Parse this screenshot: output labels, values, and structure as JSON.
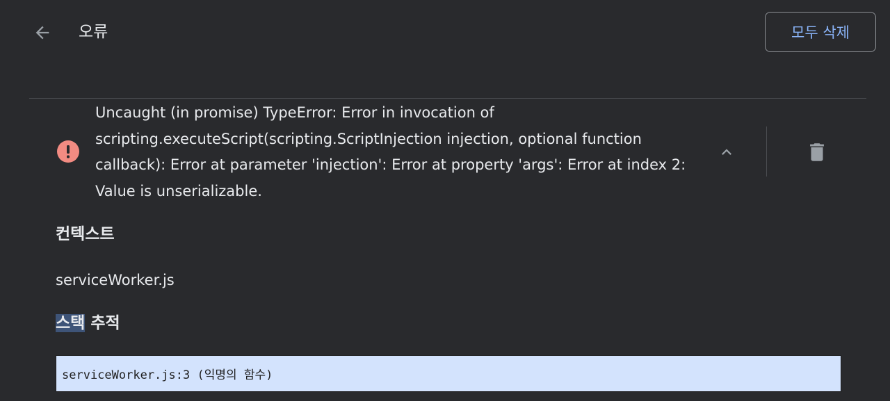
{
  "header": {
    "back_icon": "arrow-left-icon",
    "title": "오류",
    "clear_all_label": "모두 삭제"
  },
  "error": {
    "status_icon": "error-circle-icon",
    "message": "Uncaught (in promise) TypeError: Error in invocation of scripting.executeScript(scripting.ScriptInjection injection, optional function callback): Error at parameter 'injection': Error at property 'args': Error at index 2: Value is unserializable.",
    "collapse_icon": "chevron-up-icon",
    "delete_icon": "trash-icon"
  },
  "details": {
    "context_heading": "컨텍스트",
    "context_value": "serviceWorker.js",
    "stack_heading_selected": "스택",
    "stack_heading_rest": " 추적",
    "stack_frames": [
      "serviceWorker.js:3 (익명의 함수)"
    ]
  },
  "colors": {
    "background": "#292a2d",
    "accent": "#8ab4f8",
    "error_badge": "#f28b82",
    "stack_box": "#d3e3fd"
  }
}
